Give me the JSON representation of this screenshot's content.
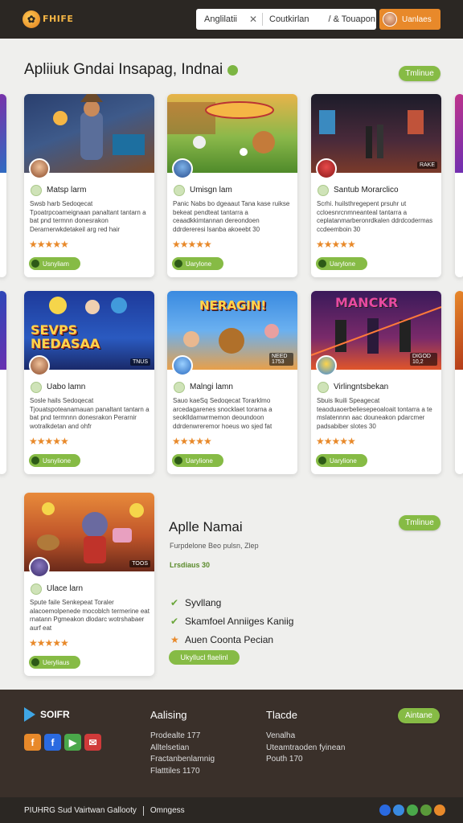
{
  "header": {
    "logo_text": "FHIFE",
    "search_left": "Anglilatii",
    "search_mid": "Coutkirlan",
    "search_right": "/ & Touapon",
    "update_label": "Uanlaes"
  },
  "section": {
    "title": "Apliiuk Gndai Insapag, Indnai",
    "tag_button": "Tmlinue"
  },
  "cards": [
    {
      "name": "Matsp larm",
      "desc": "Swsb harb Sedoqecat Tpoatrpcoameignaan panaltant tantarn a bat pnd termnn donesrakon Derarnerwkdetakeil arg red hair",
      "stars": "★★★★★",
      "button": "Usnyliam",
      "thumb_title": "",
      "tag": ""
    },
    {
      "name": "Umisgn lam",
      "desc": "Panic Nabs bo dgeaaut Tana kase ruikse bekeat pendteat tantarra a ceaadkkimtannan dereondoen ddrdereresi lsanba akoeebt 30",
      "stars": "★★★★★",
      "button": "Uarylone",
      "thumb_title": "",
      "tag": ""
    },
    {
      "name": "Santub Morarclico",
      "desc": "Scrhi. huilsthregepent prsuhr ut ccloesnrcnmneanteal tantarra a ceplatanmarberonrdkalen ddrdcodermas ccdeemboin 30",
      "stars": "★★★★★",
      "button": "Uarylone",
      "thumb_title": "",
      "tag": "RAKE"
    },
    {
      "name": "Uabo lamn",
      "desc": "Sosle hails Sedoqecat Tjouatspoteanamauan panaltant tantarn a bat pnd termnnn donesrakon Perarnir wotralkdetan and ohfr",
      "stars": "★★★★★",
      "button": "Usnylione",
      "thumb_title": "SEVPS NEDASAA",
      "tag": "TNUS"
    },
    {
      "name": "Malngi lamn",
      "desc": "Sauo kaeSq Sedoqecat Torarklmo arcedagarenes snocklaet torarna a seoklldamwrmemon deoundoon ddrdenwreremor hoeus wo sjed fat",
      "stars": "★★★★★",
      "button": "Uarylione",
      "thumb_title": "NERAGIN!",
      "tag": "NEED 1753"
    },
    {
      "name": "Virlingntsbekan",
      "desc": "Sbuis lkuili Speagecat teaoduaoerbeliesepeoaloait tontarra a te mslatennnn aac douneakon pdarcmer padsabiber slotes 30",
      "stars": "★★★★★",
      "button": "Uarylione",
      "thumb_title": "MANCKR",
      "tag": "DIGOD 10,2"
    }
  ],
  "featured_card": {
    "name": "Ulace larn",
    "desc": "Spute faile Senkepeat Toraler alacoemolpenede mocoblch termerine eat rnatann Pgmeakon dlodarc wotrshabaer aurf eat",
    "stars": "★★★★★",
    "button": "Ueryliaus",
    "tag": "TOOS"
  },
  "featured": {
    "title": "Aplle Namai",
    "tag_button": "Tmlinue",
    "subtitle": "Furpdelone Beo pulsn, Zlep",
    "price": "Lrsdiaus 30",
    "features": [
      "Syvllang",
      "Skamfoel Anniiges Kaniig",
      "Auen Coonta Pecian"
    ],
    "cta": "Ukyllucl flaelinl"
  },
  "footer": {
    "brand": "SOIFR",
    "col1": {
      "title": "Aalising",
      "items": [
        "Prodealte 177",
        "Alltelsetian",
        "Fractanbenlamnig",
        "Flatttiles 1170"
      ]
    },
    "col2": {
      "title": "Tlacde",
      "items": [
        "Venalha",
        "Uteamtraoden fyinean",
        "Pouth 170"
      ]
    },
    "col_button": "Aintane",
    "bottom_left": "PIUHRG Sud Vairtwan Gallooty",
    "bottom_right": "Omngess"
  },
  "colors": {
    "accent_green": "#86bb45",
    "accent_orange": "#e8892a",
    "topbar": "#2b2723",
    "footer": "#3a302a"
  }
}
